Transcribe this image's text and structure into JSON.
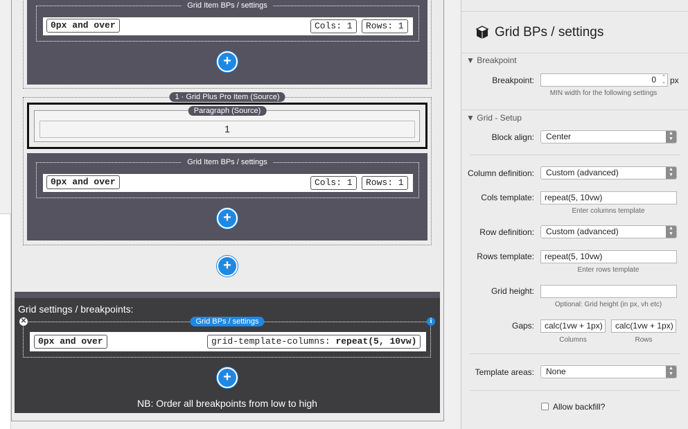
{
  "canvas": {
    "block1": {
      "settings_label": "Grid Item BPs / settings",
      "bp_label": "0px and over",
      "cols_label": "Cols: 1",
      "rows_label": "Rows: 1",
      "add_label": "+"
    },
    "block2": {
      "item_label": "1 · Grid Plus Pro Item (Source)",
      "paragraph_label": "Paragraph (Source)",
      "paragraph_value": "1",
      "settings_label": "Grid Item BPs / settings",
      "bp_label": "0px and over",
      "cols_label": "Cols: 1",
      "rows_label": "Rows: 1",
      "add_label": "+"
    },
    "outer_add_label": "+",
    "grid_settings": {
      "title": "Grid settings / breakpoints:",
      "tag": "Grid BPs / settings",
      "bp_label": "0px and over",
      "css_prefix": "grid-template-columns: ",
      "css_value": "repeat(5, 10vw)",
      "add_label": "+",
      "note": "NB: Order all breakpoints from low to high"
    }
  },
  "inspector": {
    "title": "Grid BPs / settings",
    "breakpoint_section": "Breakpoint",
    "breakpoint_label": "Breakpoint:",
    "breakpoint_value": "0",
    "breakpoint_unit": "px",
    "breakpoint_hint": "MIN width for the following settings",
    "setup_section": "Grid - Setup",
    "block_align_label": "Block align:",
    "block_align_value": "Center",
    "column_def_label": "Column definition:",
    "column_def_value": "Custom (advanced)",
    "cols_template_label": "Cols template:",
    "cols_template_value": "repeat(5, 10vw)",
    "cols_template_hint": "Enter columns template",
    "row_def_label": "Row definition:",
    "row_def_value": "Custom (advanced)",
    "rows_template_label": "Rows template:",
    "rows_template_value": "repeat(5, 10vw)",
    "rows_template_hint": "Enter rows template",
    "grid_height_label": "Grid height:",
    "grid_height_value": "",
    "grid_height_hint": "Optional: Grid height (in px, vh etc)",
    "gaps_label": "Gaps:",
    "gap_columns_value": "calc(1vw + 1px)",
    "gap_rows_value": "calc(1vw + 1px)",
    "gap_columns_hint": "Columns",
    "gap_rows_hint": "Rows",
    "template_areas_label": "Template areas:",
    "template_areas_value": "None",
    "allow_backfill_label": "Allow backfill?"
  },
  "colors": {
    "accent": "#1e88e5",
    "panel": "#55535f",
    "dark_block": "#3d3d3f"
  }
}
